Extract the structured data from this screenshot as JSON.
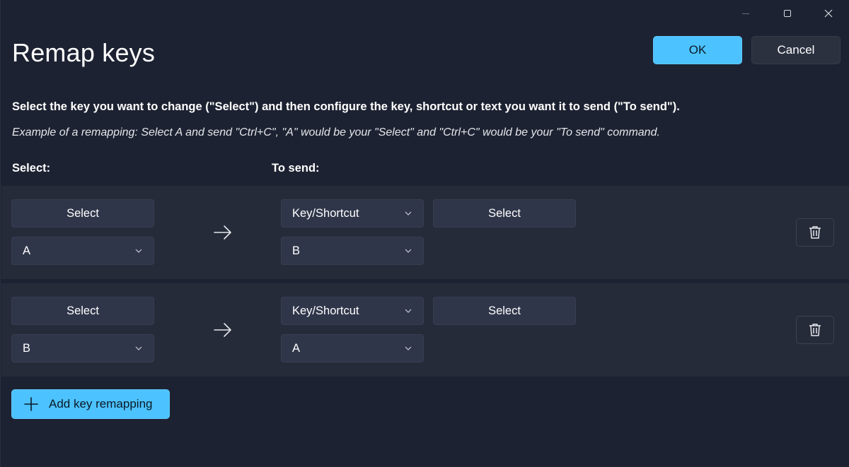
{
  "window": {
    "title": "Remap keys",
    "ok_label": "OK",
    "cancel_label": "Cancel"
  },
  "description": "Select the key you want to change (\"Select\") and then configure the key, shortcut or text you want it to send (\"To send\").",
  "example": "Example of a remapping: Select A and send \"Ctrl+C\", \"A\" would be your \"Select\" and \"Ctrl+C\" would be your \"To send\" command.",
  "columns": {
    "select": "Select:",
    "to_send": "To send:"
  },
  "rows": [
    {
      "select_button": "Select",
      "select_key": "A",
      "send_type": "Key/Shortcut",
      "send_select_button": "Select",
      "send_key": "B"
    },
    {
      "select_button": "Select",
      "select_key": "B",
      "send_type": "Key/Shortcut",
      "send_select_button": "Select",
      "send_key": "A"
    }
  ],
  "add_button": "Add key remapping",
  "icons": {
    "arrow": "arrow-right-icon",
    "delete": "trash-icon",
    "add": "plus-icon",
    "dropdown": "chevron-down-icon"
  },
  "colors": {
    "accent": "#4cc2ff",
    "background": "#1d2232",
    "row": "#262b3a",
    "control": "#30364a"
  }
}
